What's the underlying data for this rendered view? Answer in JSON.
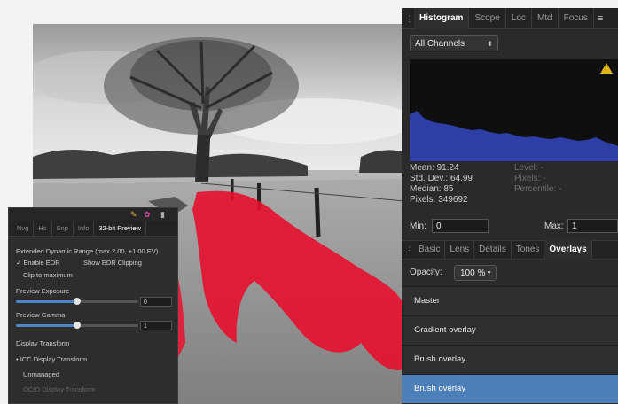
{
  "histogram_panel": {
    "tabs": [
      {
        "label": "Histogram",
        "active": true
      },
      {
        "label": "Scope",
        "active": false
      },
      {
        "label": "Loc",
        "active": false
      },
      {
        "label": "Mtd",
        "active": false
      },
      {
        "label": "Focus",
        "active": false
      }
    ],
    "channels_value": "All Channels",
    "warning_icon": "warning-triangle-icon",
    "stats": {
      "mean": "Mean: 91.24",
      "std_dev": "Std. Dev.: 64.99",
      "median": "Median: 85",
      "pixels": "Pixels: 349692",
      "level": "Level: -",
      "level_pixels": "Pixels: -",
      "percentile": "Percentile: -"
    },
    "min_label": "Min:",
    "min_value": "0",
    "max_label": "Max:",
    "max_value": "1"
  },
  "adjust_panel": {
    "tabs": [
      {
        "label": "Basic",
        "active": false
      },
      {
        "label": "Lens",
        "active": false
      },
      {
        "label": "Details",
        "active": false
      },
      {
        "label": "Tones",
        "active": false
      },
      {
        "label": "Overlays",
        "active": true
      }
    ],
    "opacity_label": "Opacity:",
    "opacity_value": "100 %",
    "overlays": [
      {
        "label": "Master",
        "selected": false
      },
      {
        "label": "Gradient overlay",
        "selected": false
      },
      {
        "label": "Brush overlay",
        "selected": false
      },
      {
        "label": "Brush overlay",
        "selected": true
      }
    ]
  },
  "preview_panel": {
    "tabs": [
      {
        "label": "Nvg",
        "active": false
      },
      {
        "label": "Hs",
        "active": false
      },
      {
        "label": "Snp",
        "active": false
      },
      {
        "label": "Info",
        "active": false
      },
      {
        "label": "32-bit Preview",
        "active": true
      }
    ],
    "edr_heading": "Extended Dynamic Range (max 2.00, +1.00 EV)",
    "enable_edr": "✓ Enable EDR",
    "show_edr_clipping": "Show EDR Clipping",
    "clip_to_maximum": "Clip to maximum",
    "exposure_label": "Preview Exposure",
    "exposure_value": "0",
    "exposure_level": 0.5,
    "gamma_label": "Preview Gamma",
    "gamma_value": "1",
    "gamma_level": 0.5,
    "display_transform_label": "Display Transform",
    "icc_option": "• ICC Display Transform",
    "unmanaged_option": "Unmanaged",
    "ocio_option": "OCIO Display Transform"
  },
  "colors": {
    "accent_blue": "#4d7fb8",
    "overlay_red": "#e8102e",
    "histogram_fill": "#2d3fa6"
  }
}
